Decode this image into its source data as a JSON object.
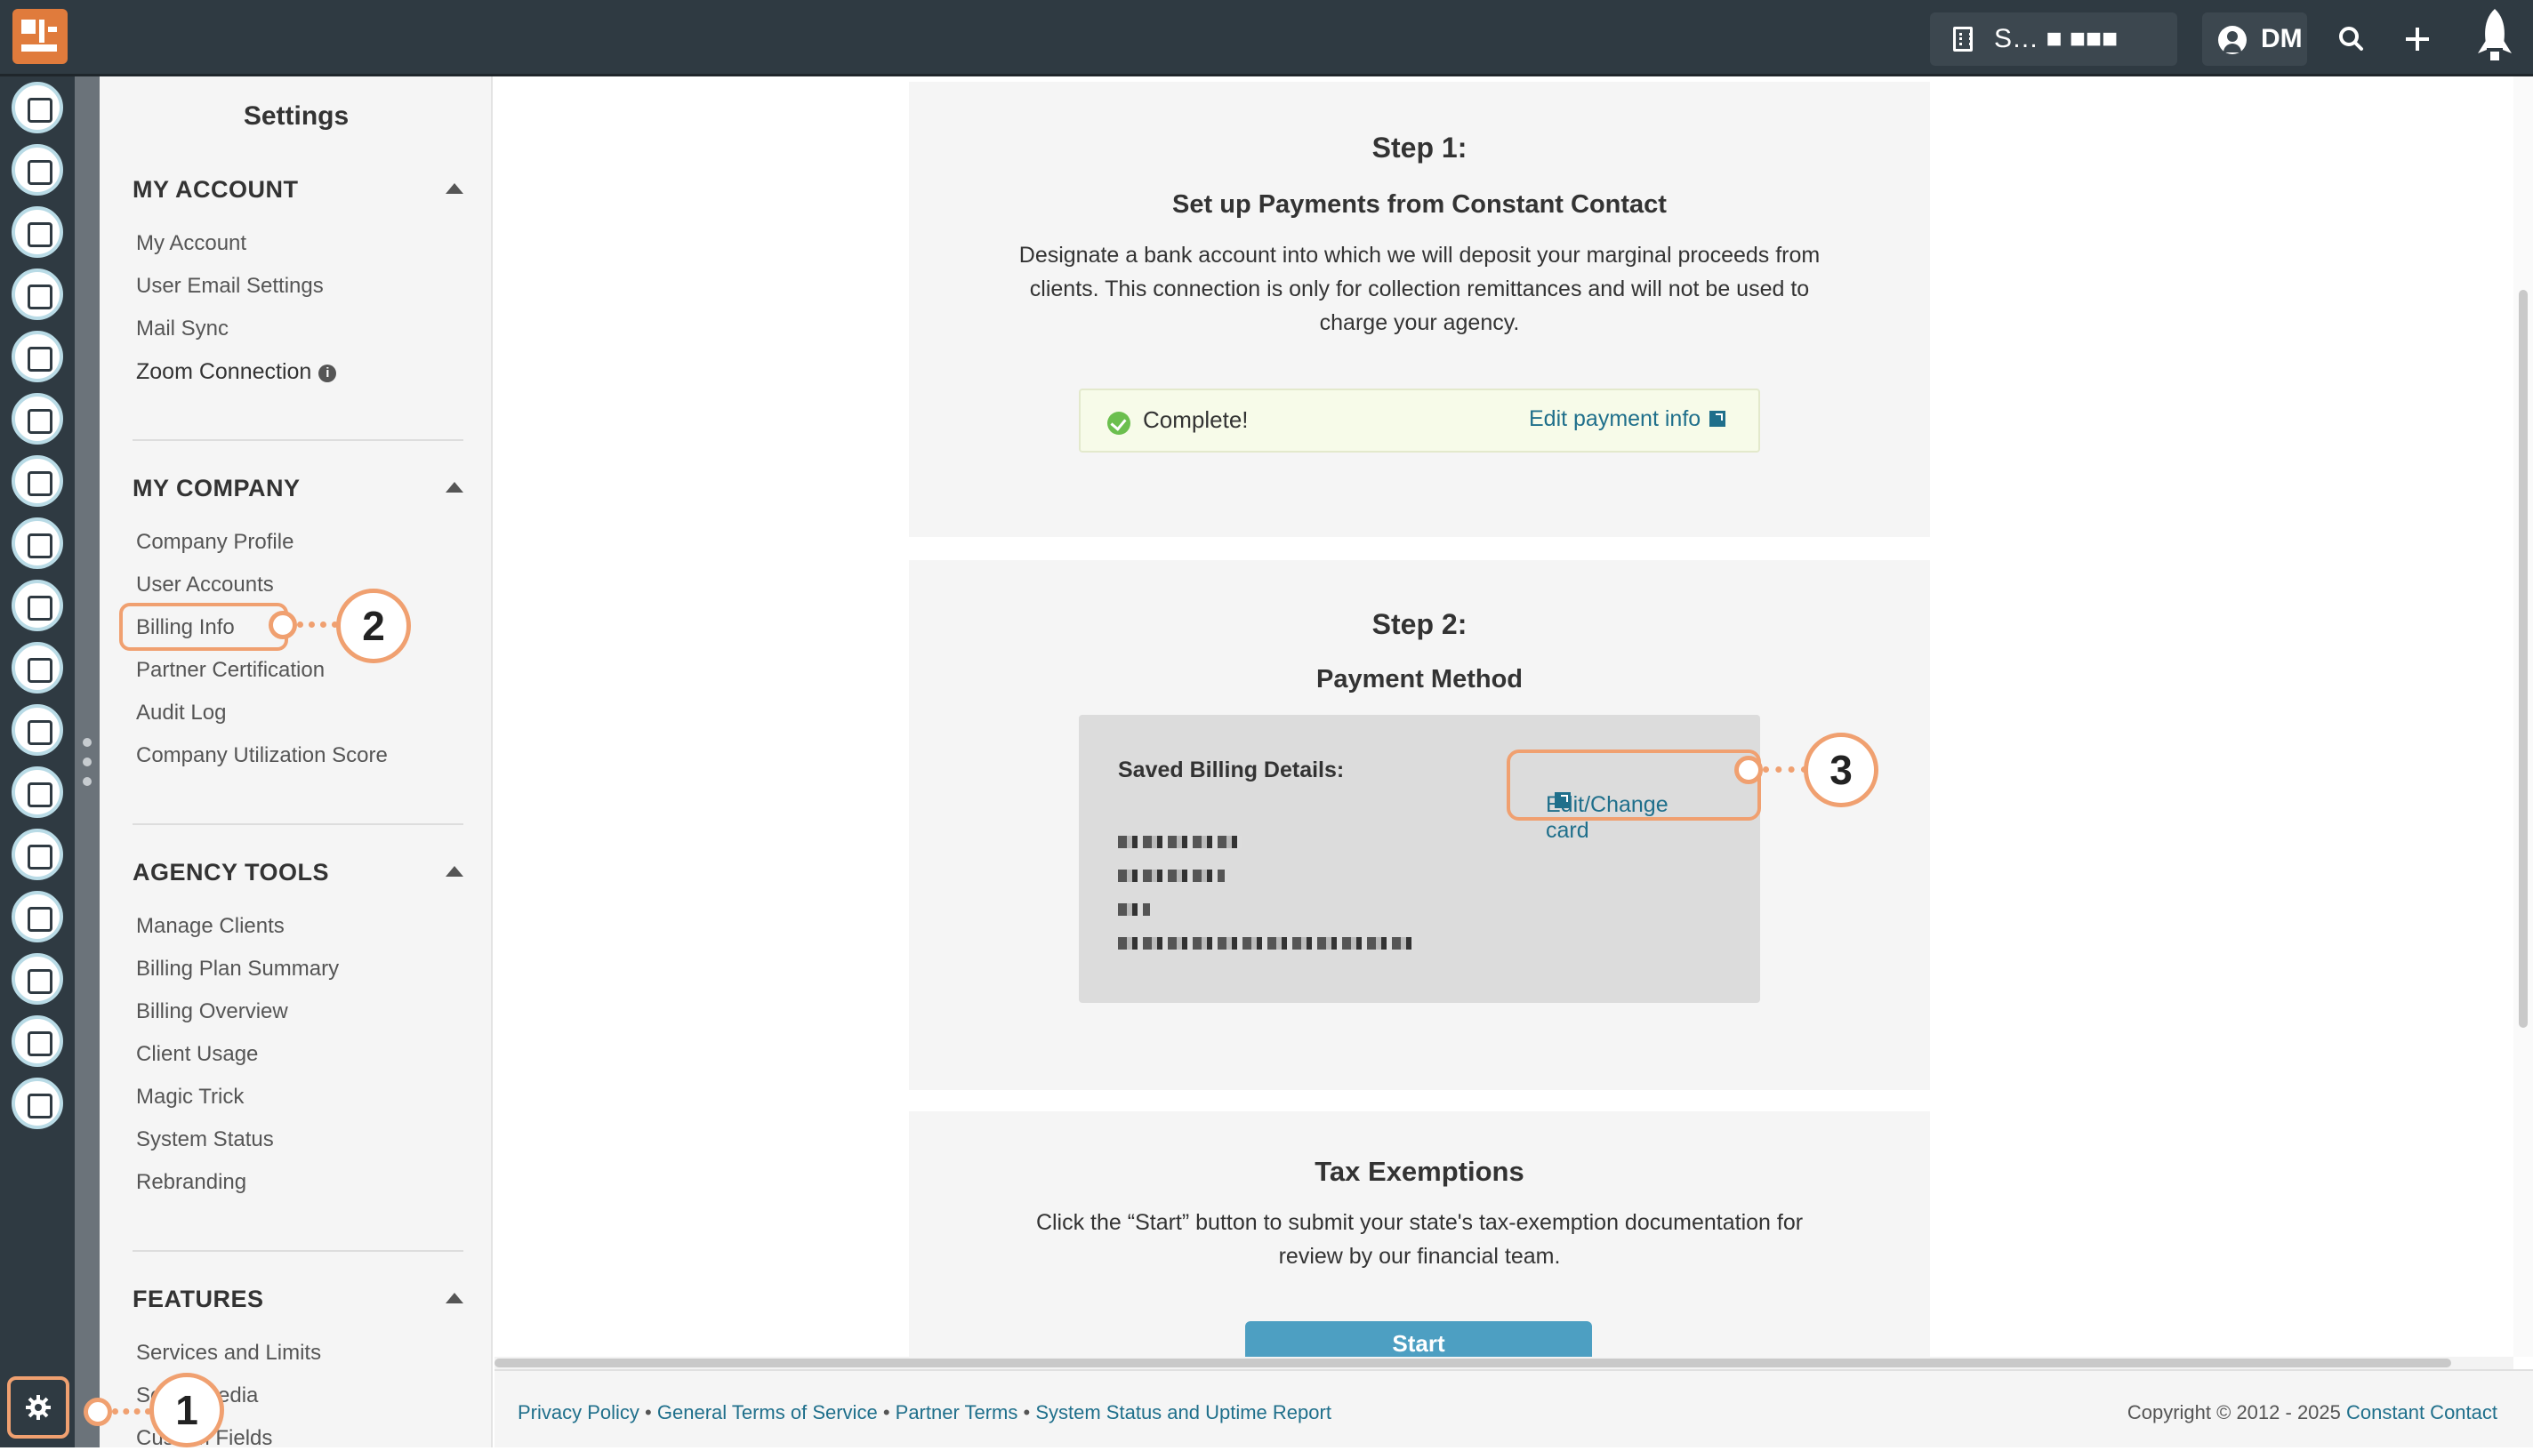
{
  "header": {
    "account_name": "S… ■ ■■■ ■■■■…",
    "user_initials": "DM",
    "icons": [
      "building-icon",
      "user-avatar-icon",
      "search-icon",
      "plus-icon",
      "rocket-icon"
    ]
  },
  "left_nav_icons": [
    "contacts-icon",
    "email-icon",
    "clipboard-icon",
    "map-icon",
    "branch-icon",
    "list-icon",
    "megaphone-icon",
    "chat-icon",
    "thumbs-up-icon",
    "image-icon",
    "calendar-icon",
    "handshake-icon",
    "growth-chart-icon",
    "support-icon",
    "user-star-icon",
    "bar-chart-icon",
    "plug-icon",
    "gear-icon"
  ],
  "settings": {
    "title": "Settings",
    "sections": [
      {
        "heading": "MY ACCOUNT",
        "items": [
          "My Account",
          "User Email Settings",
          "Mail Sync",
          "Zoom Connection"
        ]
      },
      {
        "heading": "MY COMPANY",
        "items": [
          "Company Profile",
          "User Accounts",
          "Billing Info",
          "Partner Certification",
          "Audit Log",
          "Company Utilization Score"
        ]
      },
      {
        "heading": "AGENCY TOOLS",
        "items": [
          "Manage Clients",
          "Billing Plan Summary",
          "Billing Overview",
          "Client Usage",
          "Magic Trick",
          "System Status",
          "Rebranding"
        ]
      },
      {
        "heading": "FEATURES",
        "items": [
          "Services and Limits",
          "Social Media",
          "Custom Fields"
        ]
      }
    ]
  },
  "step1": {
    "title": "Step 1:",
    "subtitle": "Set up Payments from Constant Contact",
    "body": "Designate a bank account into which we will deposit your marginal proceeds from clients. This connection is only for collection remittances and will not be used to charge your agency.",
    "status": "Complete!",
    "edit_link": "Edit payment info"
  },
  "step2": {
    "title": "Step 2:",
    "subtitle": "Payment Method",
    "saved_label": "Saved Billing Details:",
    "edit_link": "Edit/Change card"
  },
  "tax": {
    "title": "Tax Exemptions",
    "body": "Click the “Start” button to submit your state's tax-exemption documentation for review by our financial team.",
    "button": "Start"
  },
  "footer": {
    "links": [
      "Privacy Policy",
      "General Terms of Service",
      "Partner Terms",
      "System Status and Uptime Report"
    ],
    "separator": "•",
    "copyright": "Copyright © 2012 - 2025",
    "brand": "Constant Contact"
  },
  "callouts": [
    "1",
    "2",
    "3"
  ],
  "colors": {
    "topbar": "#2f3a42",
    "accent": "#e07b3c",
    "link": "#1f6f8b",
    "callout": "#f0a070",
    "button": "#4d9fc2"
  }
}
